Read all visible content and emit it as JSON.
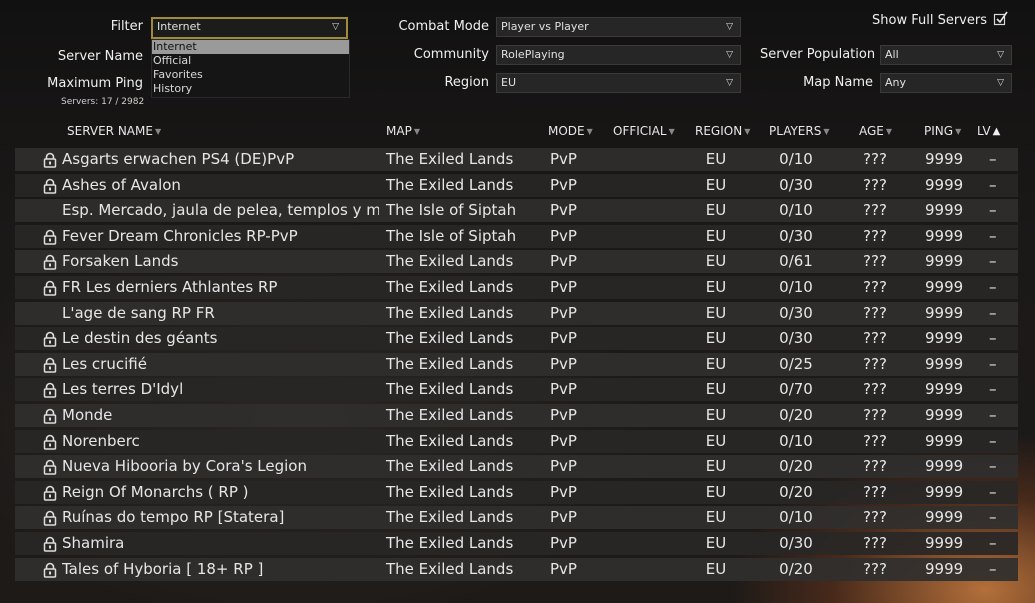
{
  "filters": {
    "filter_label": "Filter",
    "filter_value": "Internet",
    "filter_options": [
      "Internet",
      "Official",
      "Favorites",
      "History"
    ],
    "server_name_label": "Server Name",
    "max_ping_label": "Maximum Ping",
    "servers_count": "Servers: 17 / 2982",
    "combat_mode_label": "Combat Mode",
    "combat_mode_value": "Player vs Player",
    "community_label": "Community",
    "community_value": "RolePlaying",
    "region_label": "Region",
    "region_value": "EU",
    "show_full_label": "Show Full Servers",
    "show_full_checked": true,
    "population_label": "Server Population",
    "population_value": "All",
    "map_name_label": "Map Name",
    "map_name_value": "Any"
  },
  "columns": {
    "name": "SERVER NAME",
    "map": "MAP",
    "mode": "MODE",
    "official": "OFFICIAL",
    "region": "REGION",
    "players": "PLAYERS",
    "age": "AGE",
    "ping": "PING",
    "lv": "LV"
  },
  "sort": {
    "column": "lv",
    "direction": "ascending"
  },
  "servers": [
    {
      "locked": true,
      "name": "Asgarts erwachen PS4 (DE)PvP",
      "map": "The Exiled Lands",
      "mode": "PvP",
      "region": "EU",
      "players": "0/10",
      "age": "???",
      "ping": "9999",
      "lv": "–"
    },
    {
      "locked": true,
      "name": "Ashes of Avalon",
      "map": "The Exiled Lands",
      "mode": "PvP",
      "region": "EU",
      "players": "0/30",
      "age": "???",
      "ping": "9999",
      "lv": "–"
    },
    {
      "locked": false,
      "name": "Esp. Mercado, jaula de pelea, templos y mucho más",
      "map": "The Isle of Siptah",
      "mode": "PvP",
      "region": "EU",
      "players": "0/10",
      "age": "???",
      "ping": "9999",
      "lv": "–"
    },
    {
      "locked": true,
      "name": "Fever Dream Chronicles RP-PvP",
      "map": "The Isle of Siptah",
      "mode": "PvP",
      "region": "EU",
      "players": "0/30",
      "age": "???",
      "ping": "9999",
      "lv": "–"
    },
    {
      "locked": true,
      "name": "Forsaken Lands",
      "map": "The Exiled Lands",
      "mode": "PvP",
      "region": "EU",
      "players": "0/61",
      "age": "???",
      "ping": "9999",
      "lv": "–"
    },
    {
      "locked": true,
      "name": "FR Les derniers Athlantes RP",
      "map": "The Exiled Lands",
      "mode": "PvP",
      "region": "EU",
      "players": "0/10",
      "age": "???",
      "ping": "9999",
      "lv": "–"
    },
    {
      "locked": false,
      "name": "L'age de sang RP FR",
      "map": "The Exiled Lands",
      "mode": "PvP",
      "region": "EU",
      "players": "0/30",
      "age": "???",
      "ping": "9999",
      "lv": "–"
    },
    {
      "locked": true,
      "name": "Le destin des géants",
      "map": "The Exiled Lands",
      "mode": "PvP",
      "region": "EU",
      "players": "0/30",
      "age": "???",
      "ping": "9999",
      "lv": "–"
    },
    {
      "locked": true,
      "name": "Les crucifié",
      "map": "The Exiled Lands",
      "mode": "PvP",
      "region": "EU",
      "players": "0/25",
      "age": "???",
      "ping": "9999",
      "lv": "–"
    },
    {
      "locked": true,
      "name": "Les terres D'Idyl",
      "map": "The Exiled Lands",
      "mode": "PvP",
      "region": "EU",
      "players": "0/70",
      "age": "???",
      "ping": "9999",
      "lv": "–"
    },
    {
      "locked": true,
      "name": "Monde",
      "map": "The Exiled Lands",
      "mode": "PvP",
      "region": "EU",
      "players": "0/20",
      "age": "???",
      "ping": "9999",
      "lv": "–"
    },
    {
      "locked": true,
      "name": "Norenberc",
      "map": "The Exiled Lands",
      "mode": "PvP",
      "region": "EU",
      "players": "0/10",
      "age": "???",
      "ping": "9999",
      "lv": "–"
    },
    {
      "locked": true,
      "name": "Nueva Hibooria by Cora's Legion",
      "map": "The Exiled Lands",
      "mode": "PvP",
      "region": "EU",
      "players": "0/20",
      "age": "???",
      "ping": "9999",
      "lv": "–"
    },
    {
      "locked": true,
      "name": "Reign Of Monarchs ( RP )",
      "map": "The Exiled Lands",
      "mode": "PvP",
      "region": "EU",
      "players": "0/20",
      "age": "???",
      "ping": "9999",
      "lv": "–"
    },
    {
      "locked": true,
      "name": "Ruínas do tempo RP [Statera]",
      "map": "The Exiled Lands",
      "mode": "PvP",
      "region": "EU",
      "players": "0/10",
      "age": "???",
      "ping": "9999",
      "lv": "–"
    },
    {
      "locked": true,
      "name": "Shamira",
      "map": "The Exiled Lands",
      "mode": "PvP",
      "region": "EU",
      "players": "0/30",
      "age": "???",
      "ping": "9999",
      "lv": "–"
    },
    {
      "locked": true,
      "name": "Tales of Hyboria [ 18+ RP ]",
      "map": "The Exiled Lands",
      "mode": "PvP",
      "region": "EU",
      "players": "0/20",
      "age": "???",
      "ping": "9999",
      "lv": "–"
    }
  ]
}
